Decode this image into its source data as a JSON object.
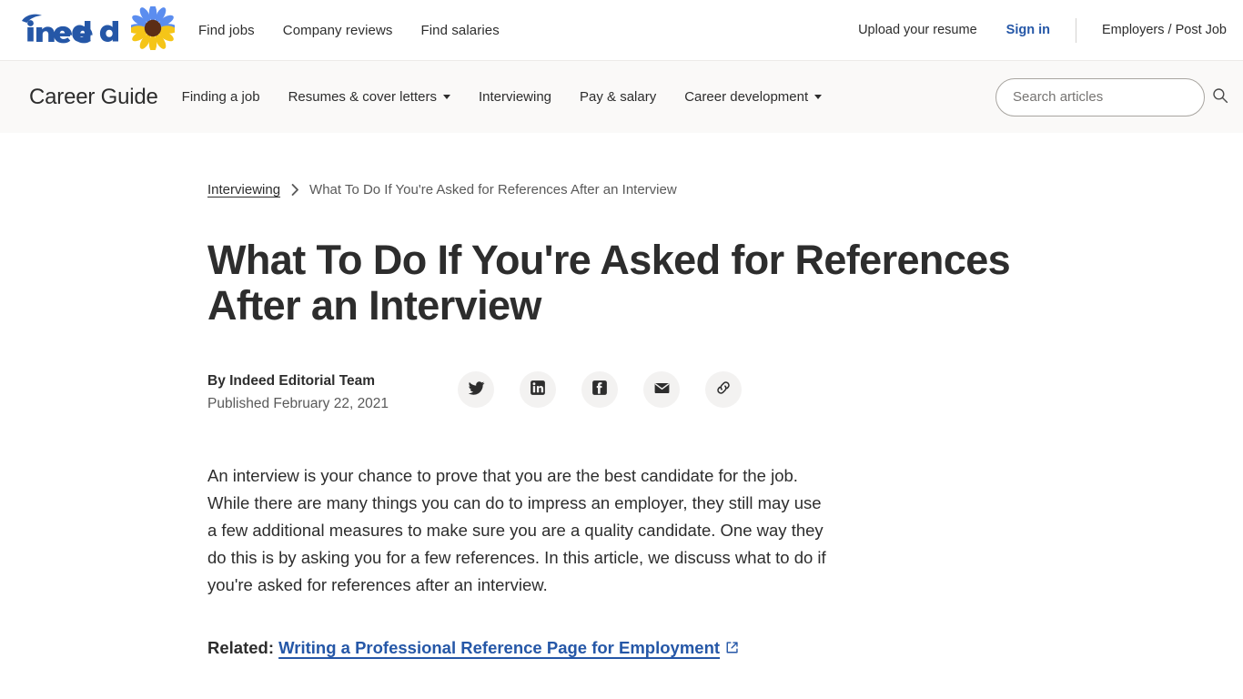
{
  "global_nav": {
    "logo": {
      "wordmark": "indeed",
      "sunflower_icon": "sunflower-icon"
    },
    "links": [
      {
        "label": "Find jobs",
        "name": "find-jobs"
      },
      {
        "label": "Company reviews",
        "name": "company-reviews"
      },
      {
        "label": "Find salaries",
        "name": "find-salaries"
      }
    ],
    "upload_resume": "Upload your resume",
    "sign_in": "Sign in",
    "employers": "Employers / Post Job"
  },
  "career_guide_nav": {
    "title": "Career Guide",
    "items": [
      {
        "label": "Finding a job",
        "dropdown": false
      },
      {
        "label": "Resumes & cover letters",
        "dropdown": true
      },
      {
        "label": "Interviewing",
        "dropdown": false
      },
      {
        "label": "Pay & salary",
        "dropdown": false
      },
      {
        "label": "Career development",
        "dropdown": true
      }
    ],
    "search": {
      "placeholder": "Search articles",
      "value": "",
      "icon": "search-icon"
    }
  },
  "article": {
    "breadcrumb": {
      "parent": "Interviewing",
      "separator": "chevron-right-icon",
      "current": "What To Do If You're Asked for References After an Interview"
    },
    "title": "What To Do If You're Asked for References After an Interview",
    "author": "By Indeed Editorial Team",
    "published": "Published February 22, 2021",
    "share_buttons": [
      {
        "name": "share-twitter-button",
        "icon": "twitter-icon"
      },
      {
        "name": "share-linkedin-button",
        "icon": "linkedin-icon"
      },
      {
        "name": "share-facebook-button",
        "icon": "facebook-icon"
      },
      {
        "name": "share-email-button",
        "icon": "email-icon"
      },
      {
        "name": "share-link-button",
        "icon": "link-icon"
      }
    ],
    "intro_paragraph": "An interview is your chance to prove that you are the best candidate for the job. While there are many things you can do to impress an employer, they still may use a few additional measures to make sure you are a quality candidate. One way they do this is by asking you for a few references. In this article, we discuss what to do if you're asked for references after an interview.",
    "related_label": "Related:",
    "related_link_text": "Writing a Professional Reference Page for Employment",
    "related_link_icon": "external-link-icon"
  },
  "colors": {
    "brand_blue": "#2557a7",
    "link_blue": "#2557a7",
    "text_dark": "#2d2d2d",
    "text_muted": "#595959",
    "band_bg": "#faf9f8",
    "share_bg": "#f3f2f1",
    "sunflower_blue": "#5b8def",
    "sunflower_yellow": "#f5c518",
    "sunflower_center": "#5c2d16"
  }
}
